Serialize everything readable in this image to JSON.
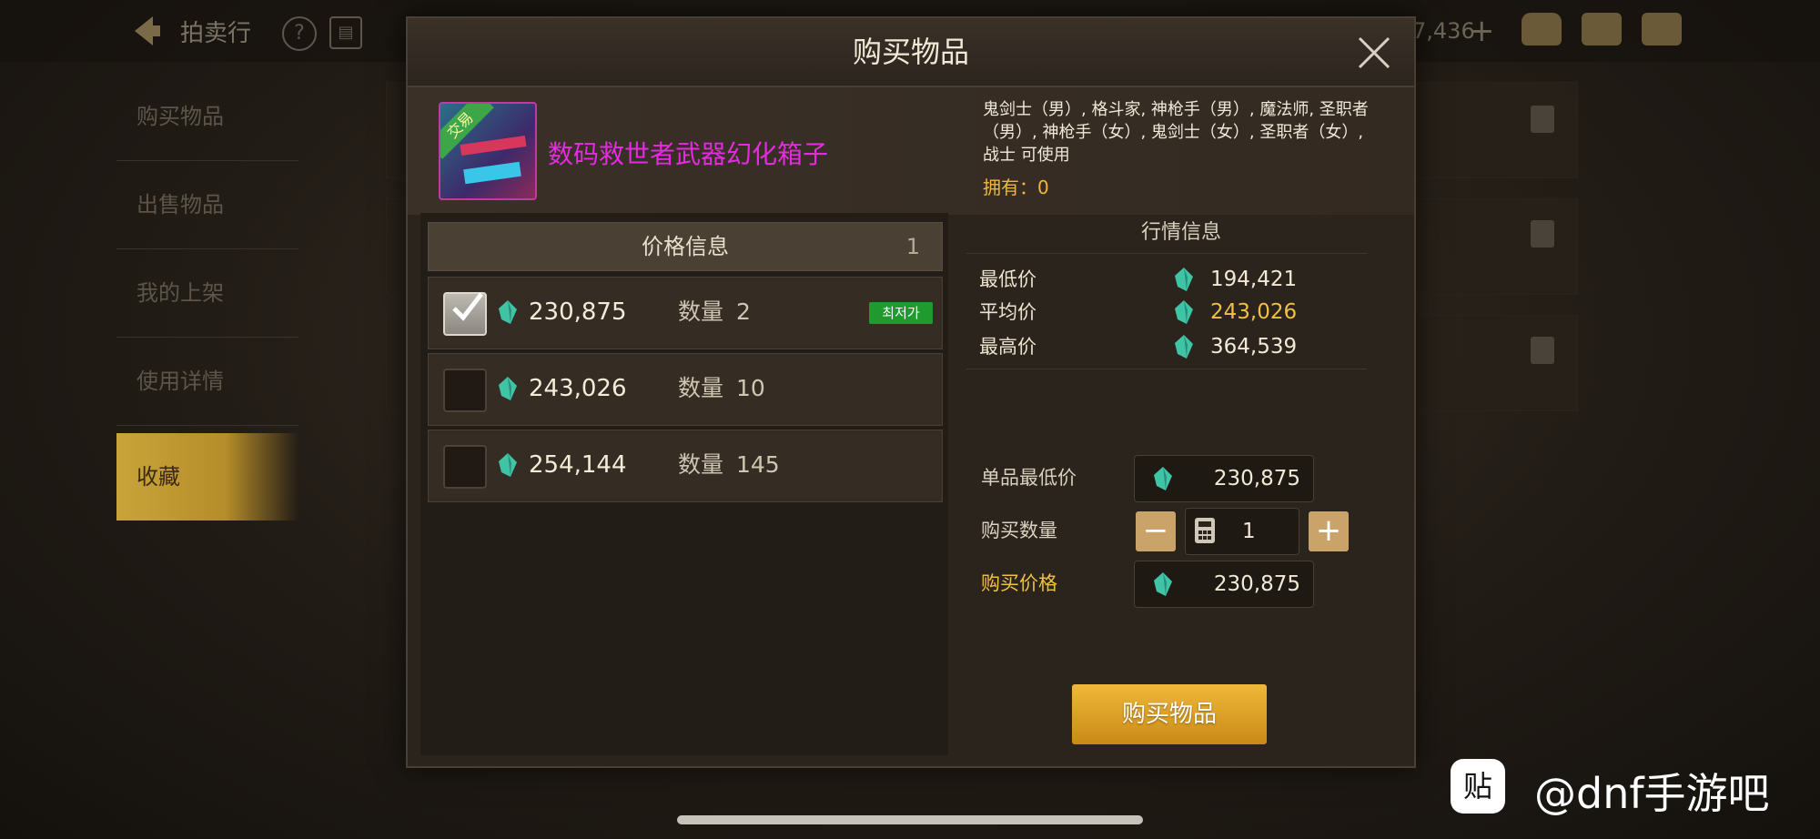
{
  "background": {
    "top_title": "拍卖行",
    "help": "?",
    "currency_partial": "7,436",
    "currency_plus": "+",
    "side_menu": [
      "购买物品",
      "出售物品",
      "我的上架",
      "使用详情",
      "收藏"
    ]
  },
  "dialog": {
    "title": "购买物品",
    "item": {
      "tag": "交易",
      "name": "数码救世者武器幻化箱子",
      "classes": "鬼剑士（男）, 格斗家, 神枪手（男）, 魔法师, 圣职者（男）, 神枪手（女）, 鬼剑士（女）, 圣职者（女）, 战士 可使用",
      "owned_label": "拥有：",
      "owned_value": "0"
    },
    "price_info": {
      "title": "价格信息",
      "page": "1",
      "qty_label": "数量",
      "lowest_badge": "최저가",
      "listings": [
        {
          "price": "230,875",
          "qty": "2",
          "checked": true
        },
        {
          "price": "243,026",
          "qty": "10",
          "checked": false
        },
        {
          "price": "254,144",
          "qty": "145",
          "checked": false
        }
      ]
    },
    "market": {
      "title": "行情信息",
      "min_label": "最低价",
      "min_value": "194,421",
      "avg_label": "平均价",
      "avg_value": "243,026",
      "max_label": "最高价",
      "max_value": "364,539"
    },
    "purchase": {
      "unit_min_label": "单品最低价",
      "unit_min_value": "230,875",
      "qty_label": "购买数量",
      "qty_value": "1",
      "minus": "−",
      "plus": "+",
      "total_label": "购买价格",
      "total_value": "230,875",
      "buy_button": "购买物品"
    }
  },
  "watermark": {
    "logo": "贴",
    "text": "@dnf手游吧"
  },
  "colors": {
    "gold": "#f0c044",
    "item_name": "#e52be0",
    "badge": "#1e9a2e",
    "button": "#e0a12a"
  }
}
